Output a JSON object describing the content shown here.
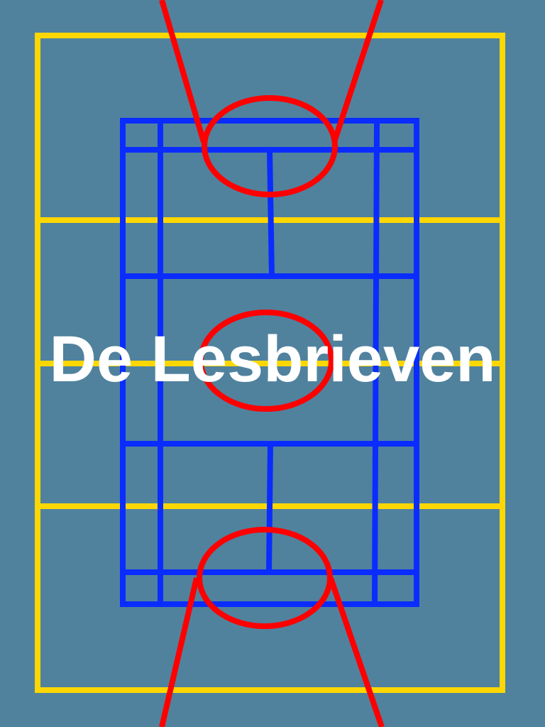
{
  "title": "De Lesbrieven",
  "colors": {
    "background": "#50829e",
    "court_outer": "#ffd700",
    "court_inner": "#0a2cff",
    "circles": "#ff0000",
    "text": "#ffffff"
  }
}
